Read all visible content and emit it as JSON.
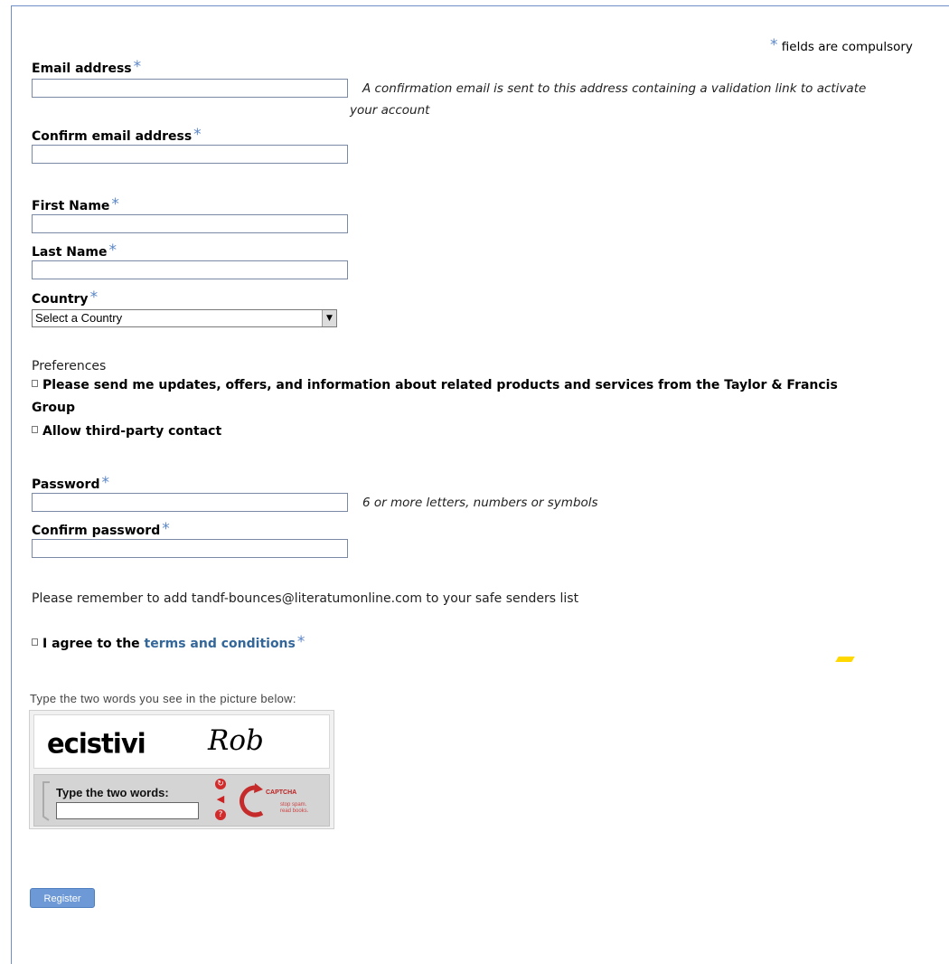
{
  "compulsory_note": "fields are compulsory",
  "required_marker": "*",
  "email": {
    "label": "Email address",
    "note_line1": "A confirmation email is sent to this address containing a validation link to activate",
    "note_line2": "your account"
  },
  "confirm_email": {
    "label": "Confirm email address"
  },
  "first_name": {
    "label": "First Name"
  },
  "last_name": {
    "label": "Last Name"
  },
  "country": {
    "label": "Country",
    "selected": "Select a Country"
  },
  "preferences": {
    "heading": "Preferences",
    "option1_line1": "Please send me updates, offers, and information about related products and services from the Taylor & Francis",
    "option1_line2": "Group",
    "option2": "Allow third-party contact"
  },
  "password": {
    "label": "Password",
    "note": "6 or more letters, numbers or symbols"
  },
  "confirm_password": {
    "label": "Confirm password"
  },
  "safe_senders": "Please remember to add tandf-bounces@literatumonline.com to your safe senders list",
  "terms": {
    "prefix": "I agree to the",
    "link": "terms and conditions"
  },
  "captcha": {
    "instruction": "Type the two words you see in the picture below:",
    "word1": "ecistivi",
    "word2": "Rob",
    "input_label": "Type the two words:",
    "logo_text": "CAPTCHA",
    "tagline1": "stop spam.",
    "tagline2": "read books."
  },
  "register_button": "Register",
  "colors": {
    "star": "#5b86c8",
    "link": "#336699",
    "register_bg": "#6d9ad6",
    "frame": "#6f8ec8"
  }
}
